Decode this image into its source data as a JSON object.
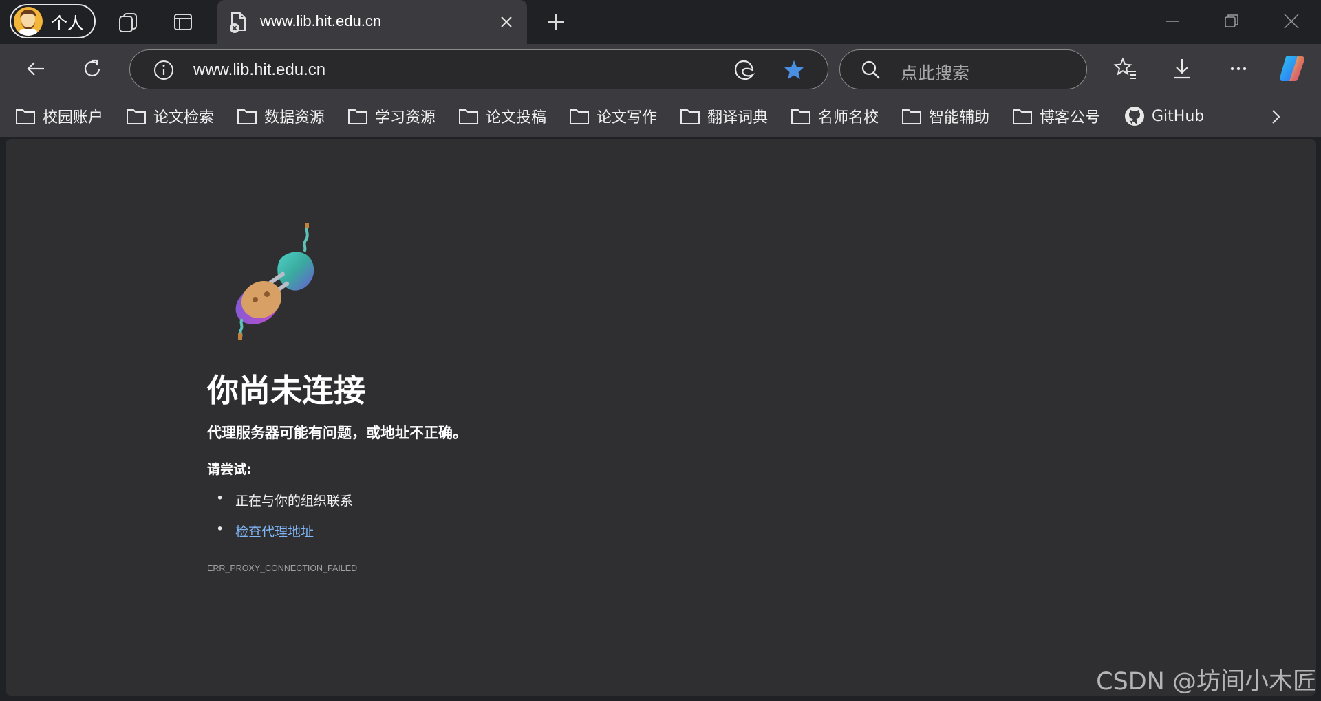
{
  "titlebar": {
    "profile_label": "个人",
    "tab": {
      "title": "www.lib.hit.edu.cn"
    }
  },
  "toolbar": {
    "url": "www.lib.hit.edu.cn",
    "search_placeholder": "点此搜索",
    "favorite_active_color": "#4a90e2"
  },
  "bookmarks": {
    "items": [
      {
        "label": "校园账户",
        "icon": "folder-icon"
      },
      {
        "label": "论文检索",
        "icon": "folder-icon"
      },
      {
        "label": "数据资源",
        "icon": "folder-icon"
      },
      {
        "label": "学习资源",
        "icon": "folder-icon"
      },
      {
        "label": "论文投稿",
        "icon": "folder-icon"
      },
      {
        "label": "论文写作",
        "icon": "folder-icon"
      },
      {
        "label": "翻译词典",
        "icon": "folder-icon"
      },
      {
        "label": "名师名校",
        "icon": "folder-icon"
      },
      {
        "label": "智能辅助",
        "icon": "folder-icon"
      },
      {
        "label": "博客公号",
        "icon": "folder-icon"
      },
      {
        "label": "GitHub",
        "icon": "github-icon"
      }
    ]
  },
  "error_page": {
    "title": "你尚未连接",
    "subtitle": "代理服务器可能有问题，或地址不正确。",
    "try_label": "请尝试:",
    "suggestions": [
      "正在与你的组织联系",
      "检查代理地址"
    ],
    "error_code": "ERR_PROXY_CONNECTION_FAILED",
    "link_color": "#7fb6f5"
  },
  "watermark": "CSDN @坊间小木匠"
}
